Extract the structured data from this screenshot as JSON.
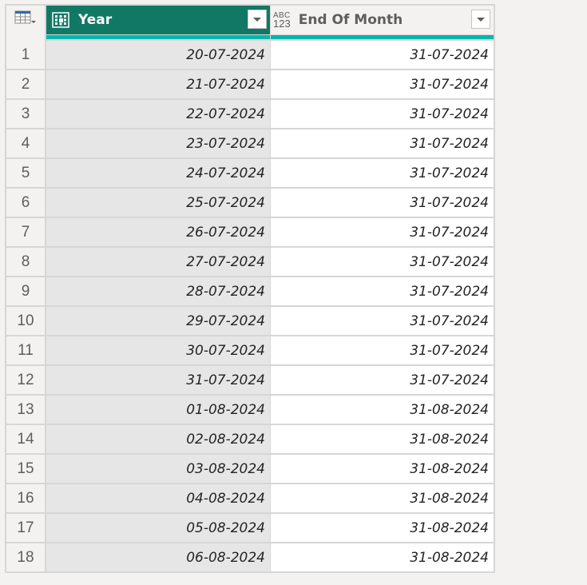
{
  "table_menu": {
    "icon": "table-icon"
  },
  "columns": [
    {
      "name": "Year",
      "type_icon": "date-type-icon",
      "selected": true
    },
    {
      "name": "End Of Month",
      "type_icon": "abc-123-any-type-icon",
      "type_icon_text_top": "ABC",
      "type_icon_text_bottom": "123",
      "selected": false
    }
  ],
  "colors": {
    "selected_header": "#117865",
    "quality_bar": "#01b8aa",
    "selected_column_bg": "#e6e6e6"
  },
  "rows": [
    {
      "n": "1",
      "year": "20-07-2024",
      "eom": "31-07-2024"
    },
    {
      "n": "2",
      "year": "21-07-2024",
      "eom": "31-07-2024"
    },
    {
      "n": "3",
      "year": "22-07-2024",
      "eom": "31-07-2024"
    },
    {
      "n": "4",
      "year": "23-07-2024",
      "eom": "31-07-2024"
    },
    {
      "n": "5",
      "year": "24-07-2024",
      "eom": "31-07-2024"
    },
    {
      "n": "6",
      "year": "25-07-2024",
      "eom": "31-07-2024"
    },
    {
      "n": "7",
      "year": "26-07-2024",
      "eom": "31-07-2024"
    },
    {
      "n": "8",
      "year": "27-07-2024",
      "eom": "31-07-2024"
    },
    {
      "n": "9",
      "year": "28-07-2024",
      "eom": "31-07-2024"
    },
    {
      "n": "10",
      "year": "29-07-2024",
      "eom": "31-07-2024"
    },
    {
      "n": "11",
      "year": "30-07-2024",
      "eom": "31-07-2024"
    },
    {
      "n": "12",
      "year": "31-07-2024",
      "eom": "31-07-2024"
    },
    {
      "n": "13",
      "year": "01-08-2024",
      "eom": "31-08-2024"
    },
    {
      "n": "14",
      "year": "02-08-2024",
      "eom": "31-08-2024"
    },
    {
      "n": "15",
      "year": "03-08-2024",
      "eom": "31-08-2024"
    },
    {
      "n": "16",
      "year": "04-08-2024",
      "eom": "31-08-2024"
    },
    {
      "n": "17",
      "year": "05-08-2024",
      "eom": "31-08-2024"
    },
    {
      "n": "18",
      "year": "06-08-2024",
      "eom": "31-08-2024"
    }
  ]
}
